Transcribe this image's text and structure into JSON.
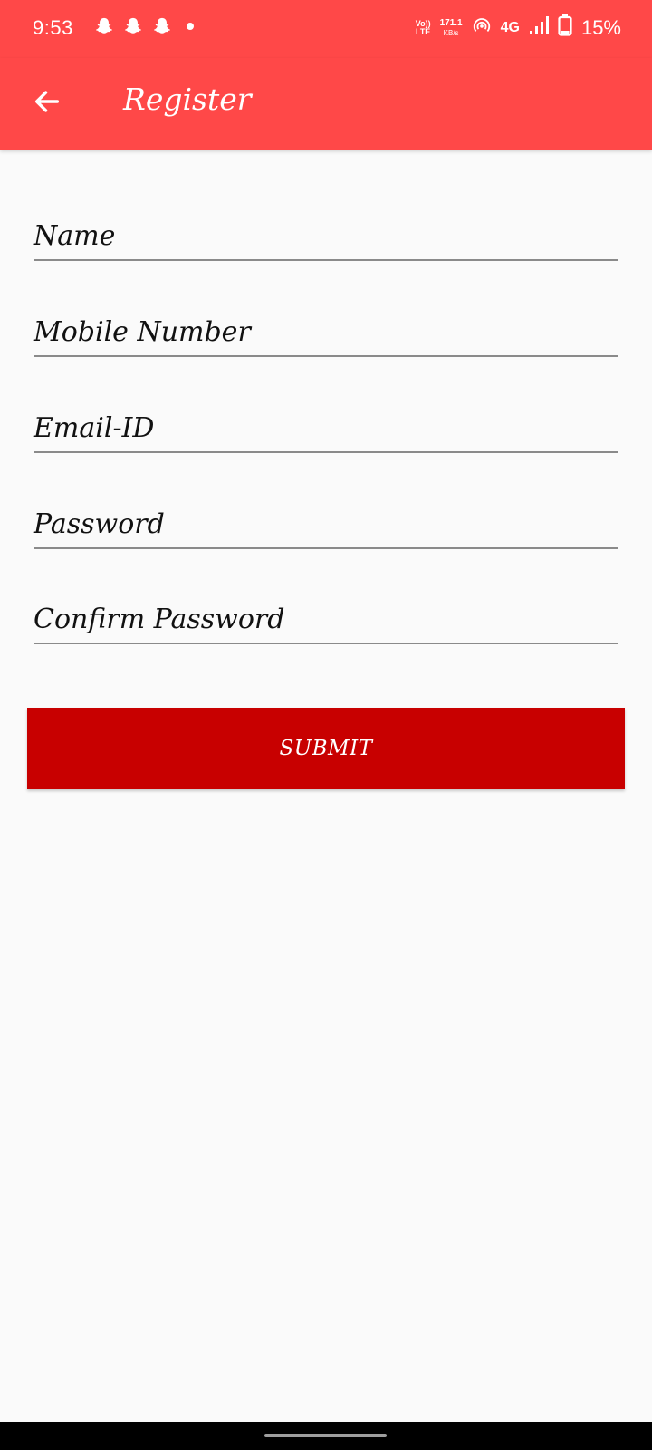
{
  "status_bar": {
    "time": "9:53",
    "notification_icons": [
      "snapchat-icon",
      "snapchat-icon",
      "snapchat-icon",
      "dot-icon"
    ],
    "volte_line1": "Vo))",
    "volte_line2": "LTE",
    "net_speed": "171.1",
    "net_speed_unit": "KB/s",
    "network_type": "4G",
    "battery_percent": "15%"
  },
  "app_bar": {
    "title": "Register",
    "back_icon": "arrow-back-icon",
    "background_color": "#FF4848"
  },
  "form": {
    "fields": [
      {
        "label": "Name"
      },
      {
        "label": "Mobile Number"
      },
      {
        "label": "Email-ID"
      },
      {
        "label": "Password"
      },
      {
        "label": "Confirm Password"
      }
    ],
    "submit_label": "SUBMIT",
    "submit_color": "#C80000"
  }
}
